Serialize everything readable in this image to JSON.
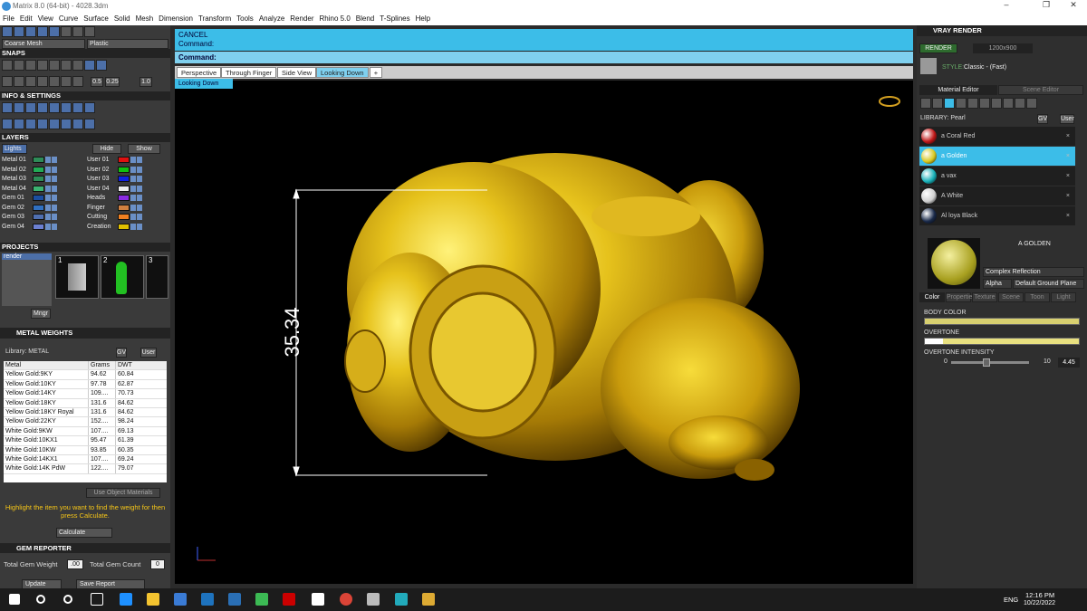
{
  "window": {
    "title": "Matrix 8.0 (64-bit) - 4028.3dm",
    "min": "–",
    "max": "❐",
    "close": "✕"
  },
  "menu": [
    "File",
    "Edit",
    "View",
    "Curve",
    "Surface",
    "Solid",
    "Mesh",
    "Dimension",
    "Transform",
    "Tools",
    "Analyze",
    "Render",
    "Rhino 5.0",
    "Blend",
    "T-Splines",
    "Help"
  ],
  "left": {
    "mesh_select": "Coarse Mesh",
    "material_select": "Plastic",
    "snaps": "SNAPS",
    "info": "INFO & SETTINGS",
    "layers": "LAYERS",
    "lights": "Lights",
    "hide": "Hide",
    "show": "Show",
    "snap_vals": [
      "0.5",
      "0.25",
      "1.0"
    ],
    "layer_left": [
      {
        "n": "Metal 01",
        "c": "#2e8b57"
      },
      {
        "n": "Metal 02",
        "c": "#22aa55"
      },
      {
        "n": "Metal 03",
        "c": "#2e8b57"
      },
      {
        "n": "Metal 04",
        "c": "#3cb371"
      },
      {
        "n": "Gem 01",
        "c": "#1b4ea0"
      },
      {
        "n": "Gem 02",
        "c": "#3070c0"
      },
      {
        "n": "Gem 03",
        "c": "#4f6fb0"
      },
      {
        "n": "Gem 04",
        "c": "#6b7fd0"
      }
    ],
    "layer_right": [
      {
        "n": "User 01",
        "c": "#e01010"
      },
      {
        "n": "User 02",
        "c": "#10c010"
      },
      {
        "n": "User 03",
        "c": "#1020e0"
      },
      {
        "n": "User 04",
        "c": "#eeeeee"
      },
      {
        "n": "Heads",
        "c": "#8a2be2"
      },
      {
        "n": "Finger",
        "c": "#d08040"
      },
      {
        "n": "Cutting",
        "c": "#f08020"
      },
      {
        "n": "Creation",
        "c": "#e0c000"
      }
    ],
    "projects": "PROJECTS",
    "project_item": "render",
    "thumbs": [
      "1",
      "2",
      "3"
    ],
    "mngr": "Mngr",
    "metal_weights": "METAL WEIGHTS",
    "library": "Library: METAL",
    "gv": "GV",
    "user": "User",
    "table_headers": [
      "Metal",
      "Grams",
      "DWT"
    ],
    "table_rows": [
      [
        "Yellow Gold:9KY",
        "94.62",
        "60.84"
      ],
      [
        "Yellow Gold:10KY",
        "97.78",
        "62.87"
      ],
      [
        "Yellow Gold:14KY",
        "109....",
        "70.73"
      ],
      [
        "Yellow Gold:18KY",
        "131.6",
        "84.62"
      ],
      [
        "Yellow Gold:18KY Royal",
        "131.6",
        "84.62"
      ],
      [
        "Yellow Gold:22KY",
        "152....",
        "98.24"
      ],
      [
        "White Gold:9KW",
        "107....",
        "69.13"
      ],
      [
        "White Gold:10KX1",
        "95.47",
        "61.39"
      ],
      [
        "White Gold:10KW",
        "93.85",
        "60.35"
      ],
      [
        "White Gold:14KX1",
        "107....",
        "69.24"
      ],
      [
        "White Gold:14K PdW",
        "122....",
        "79.07"
      ]
    ],
    "use_object": "Use Object Materials",
    "hint": "Highlight the item you want to find the weight for then press Calculate.",
    "calculate": "Calculate",
    "gem_reporter": "GEM REPORTER",
    "total_gem_weight": "Total Gem Weight",
    "tgw_val": ".00",
    "total_gem_count": "Total Gem Count",
    "tgc_val": "0",
    "update": "Update",
    "save_report": "Save Report"
  },
  "command": {
    "line1": "CANCEL",
    "line2": "Command:",
    "line3": "Command:"
  },
  "tabs": [
    "Perspective",
    "Through Finger",
    "Side View",
    "Looking Down"
  ],
  "view_label": "Looking Down",
  "dimension": "35.34",
  "right": {
    "vray": "VRAY RENDER",
    "render": "RENDER",
    "resolution": "1200x900",
    "style_label": "STYLE:",
    "style_value": "Classic - (Fast)",
    "mat_editor": "Material Editor",
    "scene_editor": "Scene Editor",
    "library": "LIBRARY: Pearl",
    "gv": "GV",
    "user": "User",
    "materials": [
      {
        "n": "a Coral Red",
        "c": "#c01818"
      },
      {
        "n": "a Golden",
        "c": "#d8c820"
      },
      {
        "n": "a vax",
        "c": "#18b0b8"
      },
      {
        "n": "A White",
        "c": "#d0d0d0"
      },
      {
        "n": "Al loya Black",
        "c": "#1a2a4a"
      }
    ],
    "preview_title": "A GOLDEN",
    "complex": "Complex Reflection",
    "alpha": "Alpha",
    "ground": "Default Ground Plane",
    "subtabs": [
      "Color",
      "Properties",
      "Texture",
      "Scene",
      "Toon",
      "Light"
    ],
    "body_color": "BODY COLOR",
    "overtone": "OVERTONE",
    "overtone_int": "OVERTONE INTENSITY",
    "int_min": "0",
    "int_max": "10",
    "int_val": "4.45",
    "colors": {
      "body": "#d8d070",
      "overtone": "#e8e080"
    }
  },
  "taskbar": {
    "lang": "ENG",
    "time": "12:16 PM",
    "date": "10/22/2022"
  },
  "colors": {
    "cyan": "#3cbde8",
    "gold": "#d4aa14"
  }
}
